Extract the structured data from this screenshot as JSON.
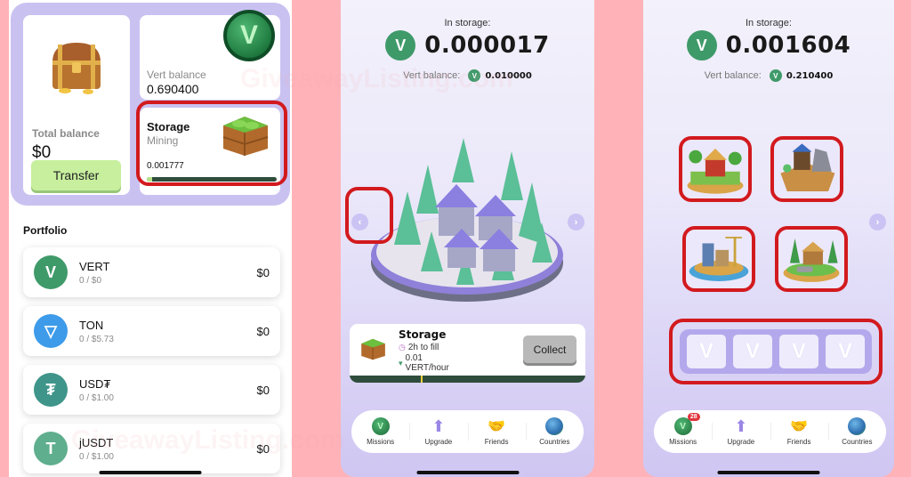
{
  "watermark": "GiveawayListing.com",
  "panel1": {
    "total_balance": {
      "label": "Total balance",
      "value": "$0",
      "button": "Transfer"
    },
    "vert_balance": {
      "label": "Vert balance",
      "value": "0.690400",
      "coin_glyph": "V"
    },
    "storage": {
      "title": "Storage",
      "subtitle": "Mining",
      "value": "0.001777",
      "fill_fraction": 0.04
    },
    "portfolio": {
      "title": "Portfolio",
      "assets": [
        {
          "name": "VERT",
          "sub": "0 / $0",
          "value": "$0",
          "icon": "vert-icon",
          "glyph": "V",
          "color": "#3f9a6a"
        },
        {
          "name": "TON",
          "sub": "0 / $5.73",
          "value": "$0",
          "icon": "ton-icon",
          "glyph": "▽",
          "color": "#3d9be9"
        },
        {
          "name": "USD₮",
          "sub": "0 / $1.00",
          "value": "$0",
          "icon": "usdt-icon",
          "glyph": "₮",
          "color": "#3f958a"
        },
        {
          "name": "jUSDT",
          "sub": "0 / $1.00",
          "value": "$0",
          "icon": "jusdt-icon",
          "glyph": "T",
          "color": "#5fae8e"
        }
      ]
    }
  },
  "panel2": {
    "in_storage_label": "In storage:",
    "in_storage_value": "0.000017",
    "vert_balance_label": "Vert balance:",
    "vert_balance_value": "0.010000",
    "storage_card": {
      "title": "Storage",
      "fill_time": "2h to fill",
      "rate_value": "0.01",
      "rate_unit": "VERT/hour",
      "collect": "Collect",
      "fill_fraction": 0.3
    }
  },
  "panel3": {
    "in_storage_label": "In storage:",
    "in_storage_value": "0.001604",
    "vert_balance_label": "Vert balance:",
    "vert_balance_value": "0.210400",
    "buildings": [
      "farm",
      "mine",
      "factory",
      "sawmill"
    ],
    "slot_glyph": "V",
    "slot_count": 4
  },
  "tabbar": {
    "tabs": [
      {
        "label": "Missions",
        "icon": "missions-icon",
        "glyph": "V"
      },
      {
        "label": "Upgrade",
        "icon": "upgrade-arrow-icon",
        "glyph": "⬆"
      },
      {
        "label": "Friends",
        "icon": "handshake-icon",
        "glyph": "🤝"
      },
      {
        "label": "Countries",
        "icon": "globe-icon",
        "glyph": ""
      }
    ],
    "missions_badge": "28"
  },
  "icons": {
    "prev": "‹",
    "next": "›",
    "clock": "◷",
    "vert_small": "▾"
  }
}
